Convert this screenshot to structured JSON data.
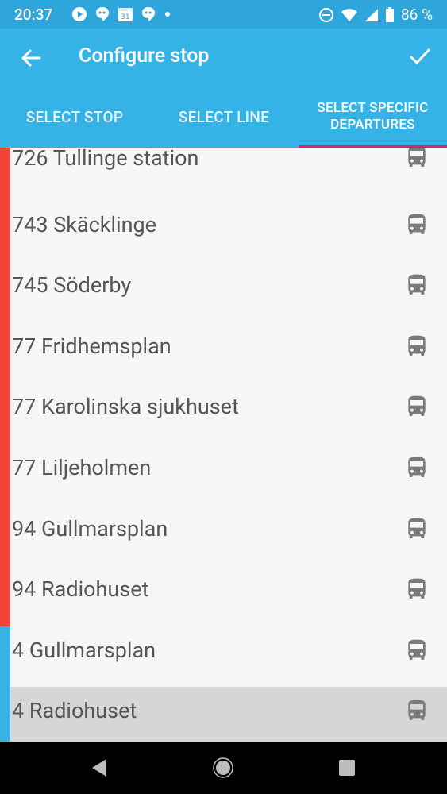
{
  "status": {
    "time": "20:37",
    "battery": "86 %"
  },
  "appbar": {
    "title": "Configure stop"
  },
  "tabs": [
    {
      "label": "SELECT STOP",
      "active": false
    },
    {
      "label": "SELECT LINE",
      "active": false
    },
    {
      "label": "SELECT SPECIFIC DEPARTURES",
      "active": true
    }
  ],
  "colors": {
    "statusbar": "#2ea6dc",
    "appbar": "#35b2e6",
    "tab_indicator": "#e91e63",
    "line_red": "#f04438",
    "line_blue": "#35b2e6"
  },
  "departures": [
    {
      "label": "726 Tullinge station",
      "line_color": "red",
      "icon": "bus-icon",
      "selected": false
    },
    {
      "label": "743 Skäcklinge",
      "line_color": "red",
      "icon": "bus-icon",
      "selected": false
    },
    {
      "label": "745 Söderby",
      "line_color": "red",
      "icon": "bus-icon",
      "selected": false
    },
    {
      "label": "77 Fridhemsplan",
      "line_color": "red",
      "icon": "bus-icon",
      "selected": false
    },
    {
      "label": "77 Karolinska sjukhuset",
      "line_color": "red",
      "icon": "bus-icon",
      "selected": false
    },
    {
      "label": "77 Liljeholmen",
      "line_color": "red",
      "icon": "bus-icon",
      "selected": false
    },
    {
      "label": "94 Gullmarsplan",
      "line_color": "red",
      "icon": "bus-icon",
      "selected": false
    },
    {
      "label": "94 Radiohuset",
      "line_color": "red",
      "icon": "bus-icon",
      "selected": false
    },
    {
      "label": "4 Gullmarsplan",
      "line_color": "blue",
      "icon": "bus-icon",
      "selected": false
    },
    {
      "label": "4 Radiohuset",
      "line_color": "blue",
      "icon": "bus-icon",
      "selected": true
    }
  ]
}
